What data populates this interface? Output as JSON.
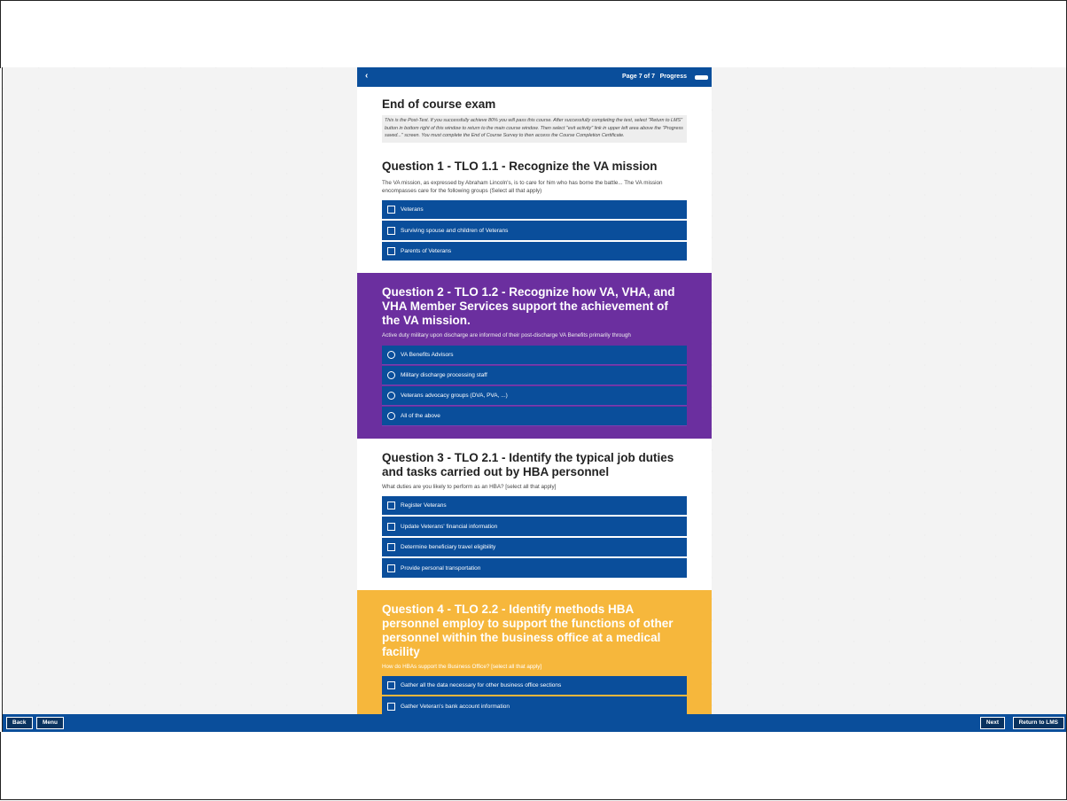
{
  "topbar": {
    "back_glyph": "‹",
    "page_indicator": "Page 7 of 7",
    "progress_label": "Progress",
    "progress_fraction": 1.0
  },
  "exam": {
    "title": "End of course exam",
    "instructions": "This is the Post-Test. If you successfully achieve 80% you will pass this course. After successfully completing the test, select \"Return to LMS\" button in bottom right of this window to return to the main course window. Then select \"exit activity\" link in upper left area above the \"Progress saved...\" screen. You must complete the End of Course Survey to then access the Course Completion Certificate."
  },
  "questions": [
    {
      "title": "Question 1 - TLO 1.1 - Recognize the VA mission",
      "prompt": "The VA mission, as expressed by Abraham Lincoln's, is to care for him who has borne the battle... The VA mission encompasses care for the following groups (Select all that apply)",
      "type": "checkbox",
      "options": [
        "Veterans",
        "Surviving spouse and children of Veterans",
        "Parents of Veterans"
      ]
    },
    {
      "title": "Question 2 - TLO 1.2 - Recognize how VA, VHA, and VHA Member Services support the achievement of the VA mission.",
      "prompt": "Active duty military upon discharge are informed of their post-discharge VA Benefits primarily  through",
      "type": "radio",
      "options": [
        "VA Benefits Advisors",
        "Military discharge processing staff",
        "Veterans advocacy groups (DVA, PVA, ...)",
        "All of the above"
      ]
    },
    {
      "title": "Question 3 - TLO 2.1 - Identify the typical job duties and tasks carried out by HBA personnel",
      "prompt": "What duties are you likely to perform as an HBA? [select all that apply]",
      "type": "checkbox",
      "options": [
        "Register Veterans",
        "Update Veterans' financial information",
        "Determine beneficiary travel eligibility",
        "Provide personal transportation"
      ]
    },
    {
      "title": "Question 4 - TLO 2.2 - Identify methods HBA personnel employ to support the functions of other personnel within the business office at a medical facility",
      "prompt": "How do HBAs support the Business Office? [select all that apply]",
      "type": "checkbox",
      "options": [
        "Gather all the data necessary for other business office sections",
        "Gather Veteran's bank account information"
      ]
    }
  ],
  "bottombar": {
    "back_label": "Back",
    "menu_label": "Menu",
    "next_label": "Next",
    "return_label": "Return to LMS"
  },
  "colors": {
    "primary_blue": "#0a4e9b",
    "q2_purple": "#6b2f9f",
    "q4_yellow": "#f6b73c"
  }
}
